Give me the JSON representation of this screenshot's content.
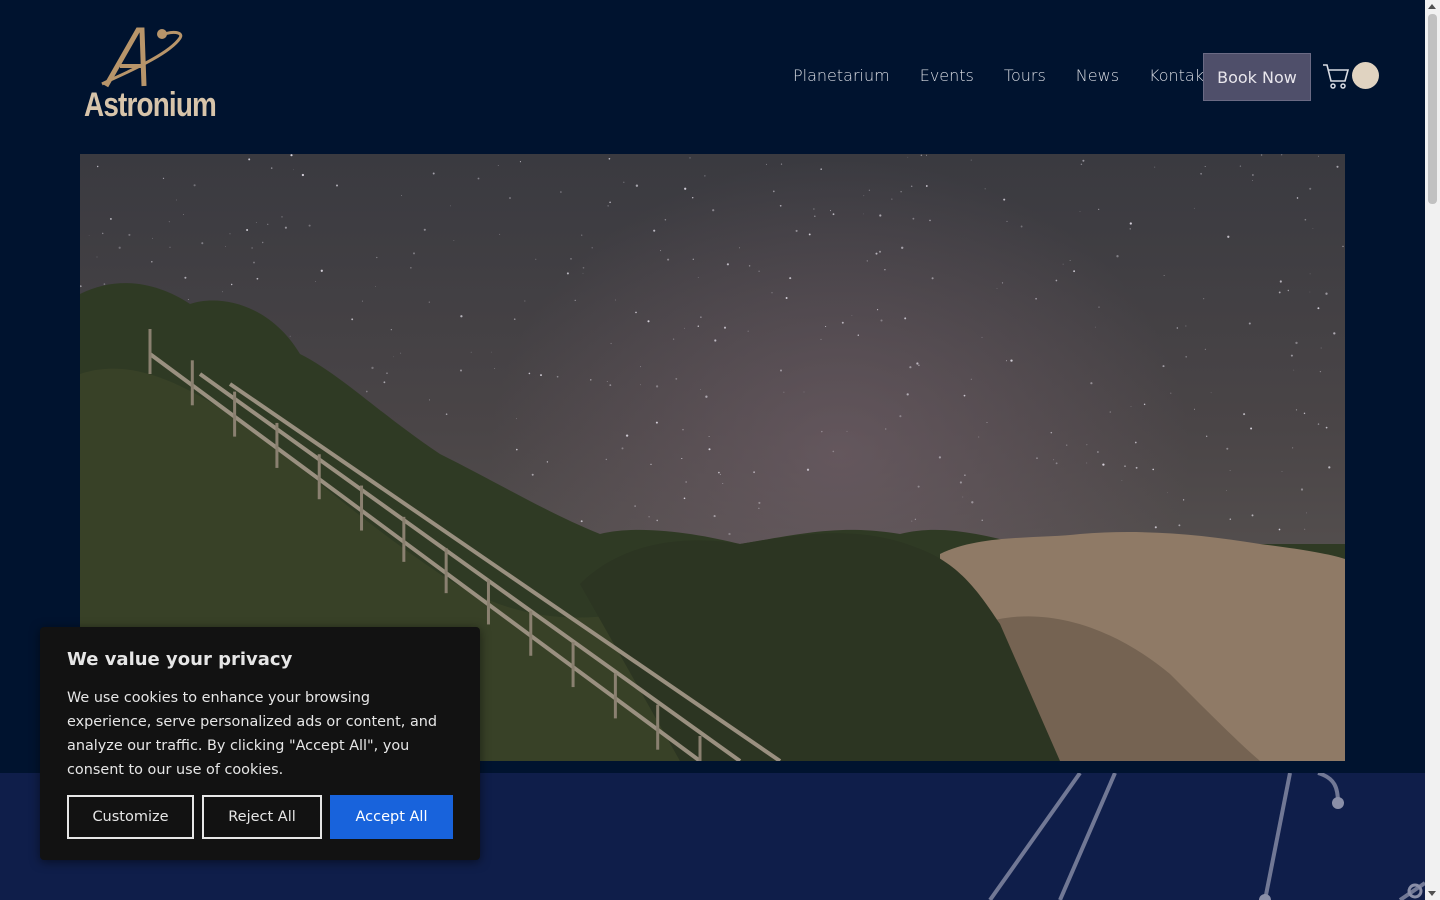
{
  "brand": {
    "name": "Astronium",
    "logo_color": "#d7c4aa"
  },
  "nav": {
    "items": [
      "Planetarium",
      "Events",
      "Tours",
      "News",
      "Kontakt"
    ],
    "book_label": "Book Now"
  },
  "icons": {
    "cart": "cart-icon",
    "avatar": "avatar",
    "social": [
      "instagram-icon",
      "facebook-icon"
    ]
  },
  "cookie": {
    "title": "We value your privacy",
    "body": "We use cookies to enhance your browsing experience, serve personalized ads or content, and analyze our traffic. By clicking \"Accept All\", you consent to our use of cookies.",
    "customize_label": "Customize",
    "reject_label": "Reject All",
    "accept_label": "Accept All",
    "accept_color": "#1863dc"
  },
  "colors": {
    "background": "#00132f",
    "band": "#0f1e4a",
    "book_button": "#4f4f6a"
  }
}
